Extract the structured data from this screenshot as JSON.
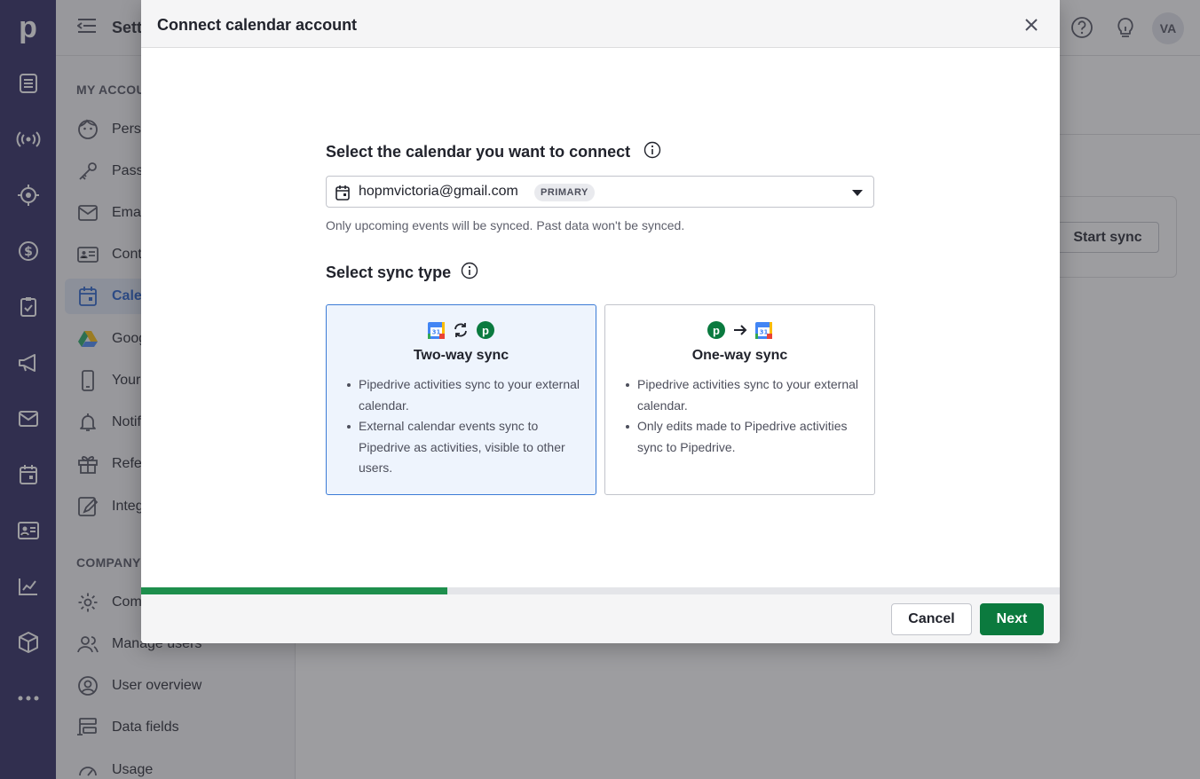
{
  "app": {
    "logo_letter": "p",
    "settings_title": "Settings",
    "user_initials": "VA"
  },
  "sidebar": {
    "my_account_label": "MY ACCOUNT",
    "my_account_items": [
      {
        "label": "Personal preferences",
        "icon": "face-icon"
      },
      {
        "label": "Password",
        "icon": "key-icon"
      },
      {
        "label": "Email sync",
        "icon": "mail-icon"
      },
      {
        "label": "Contacts sync",
        "icon": "contact-card-icon"
      },
      {
        "label": "Calendar sync",
        "icon": "calendar-icon",
        "active": true
      },
      {
        "label": "Google Drive",
        "icon": "google-drive-icon"
      },
      {
        "label": "Your devices",
        "icon": "phone-icon"
      },
      {
        "label": "Notifications",
        "icon": "bell-icon"
      },
      {
        "label": "Refer a friend",
        "icon": "gift-icon"
      },
      {
        "label": "Integrations",
        "icon": "edit-doc-icon"
      }
    ],
    "company_label": "COMPANY",
    "company_items": [
      {
        "label": "Company settings",
        "icon": "gear-icon"
      },
      {
        "label": "Manage users",
        "icon": "users-icon"
      },
      {
        "label": "User overview",
        "icon": "user-circle-icon"
      },
      {
        "label": "Data fields",
        "icon": "data-fields-icon"
      },
      {
        "label": "Usage",
        "icon": "gauge-icon"
      }
    ]
  },
  "background": {
    "start_sync_label": "Start sync"
  },
  "modal": {
    "title": "Connect calendar account",
    "calendar_question": "Select the calendar you want to connect",
    "selected_calendar": "hopmvictoria@gmail.com",
    "primary_badge": "PRIMARY",
    "hint": "Only upcoming events will be synced. Past data won't be synced.",
    "sync_type_question": "Select sync type",
    "options": [
      {
        "title": "Two-way sync",
        "selected": true,
        "bullets": [
          "Pipedrive activities sync to your external calendar.",
          "External calendar events sync to Pipedrive as activities, visible to other users."
        ]
      },
      {
        "title": "One-way sync",
        "selected": false,
        "bullets": [
          "Pipedrive activities sync to your external calendar.",
          "Only edits made to Pipedrive activities sync to Pipedrive."
        ]
      }
    ],
    "progress_fraction": 0.333,
    "cancel_label": "Cancel",
    "next_label": "Next",
    "accent_color": "#0b7a3e"
  }
}
